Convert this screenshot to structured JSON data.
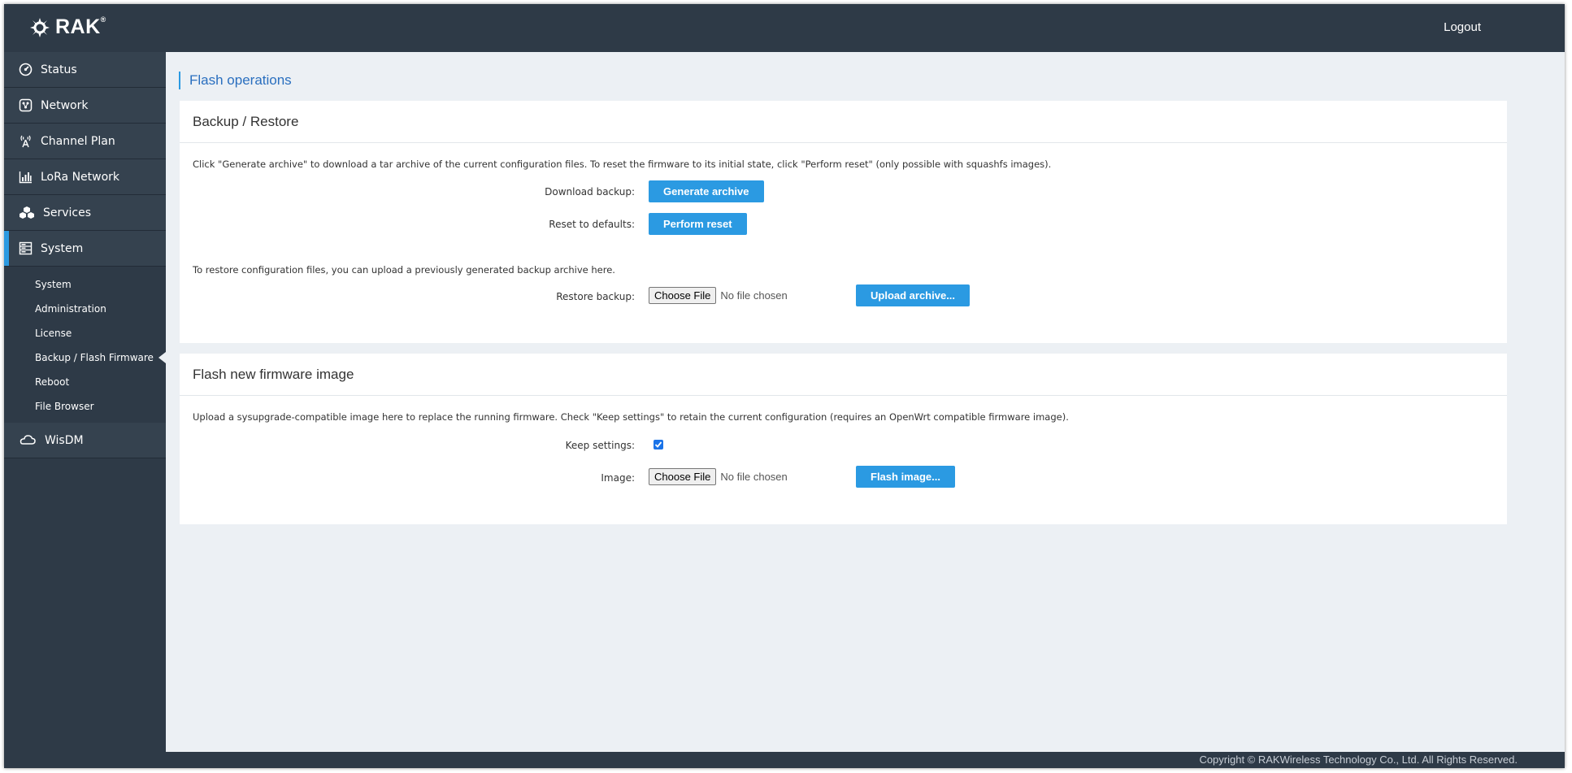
{
  "header": {
    "brand": "RAK",
    "brand_mark": "®",
    "logout_label": "Logout"
  },
  "sidebar": {
    "items": [
      {
        "label": "Status",
        "icon": "dashboard-icon"
      },
      {
        "label": "Network",
        "icon": "network-icon"
      },
      {
        "label": "Channel Plan",
        "icon": "antenna-icon"
      },
      {
        "label": "LoRa Network",
        "icon": "signal-bars-icon"
      },
      {
        "label": "Services",
        "icon": "cubes-icon"
      },
      {
        "label": "System",
        "icon": "server-icon",
        "active": true
      },
      {
        "label": "WisDM",
        "icon": "cloud-icon"
      }
    ],
    "system_subitems": [
      {
        "label": "System"
      },
      {
        "label": "Administration"
      },
      {
        "label": "License"
      },
      {
        "label": "Backup / Flash Firmware",
        "active": true
      },
      {
        "label": "Reboot"
      },
      {
        "label": "File Browser"
      }
    ]
  },
  "main": {
    "page_title": "Flash operations",
    "backup": {
      "title": "Backup / Restore",
      "description": "Click \"Generate archive\" to download a tar archive of the current configuration files. To reset the firmware to its initial state, click \"Perform reset\" (only possible with squashfs images).",
      "download_label": "Download backup:",
      "generate_button": "Generate archive",
      "reset_label": "Reset to defaults:",
      "reset_button": "Perform reset",
      "restore_description": "To restore configuration files, you can upload a previously generated backup archive here.",
      "restore_label": "Restore backup:",
      "choose_file": "Choose File",
      "no_file": "No file chosen",
      "upload_button": "Upload archive..."
    },
    "flash": {
      "title": "Flash new firmware image",
      "description": "Upload a sysupgrade-compatible image here to replace the running firmware. Check \"Keep settings\" to retain the current configuration (requires an OpenWrt compatible firmware image).",
      "keep_label": "Keep settings:",
      "keep_checked": true,
      "image_label": "Image:",
      "choose_file": "Choose File",
      "no_file": "No file chosen",
      "flash_button": "Flash image..."
    }
  },
  "footer": {
    "copyright": "Copyright © RAKWireless Technology Co., Ltd. All Rights Reserved."
  },
  "colors": {
    "sidebar_bg": "#2e3a47",
    "accent": "#2b9ae2",
    "content_bg": "#ecf0f4"
  }
}
